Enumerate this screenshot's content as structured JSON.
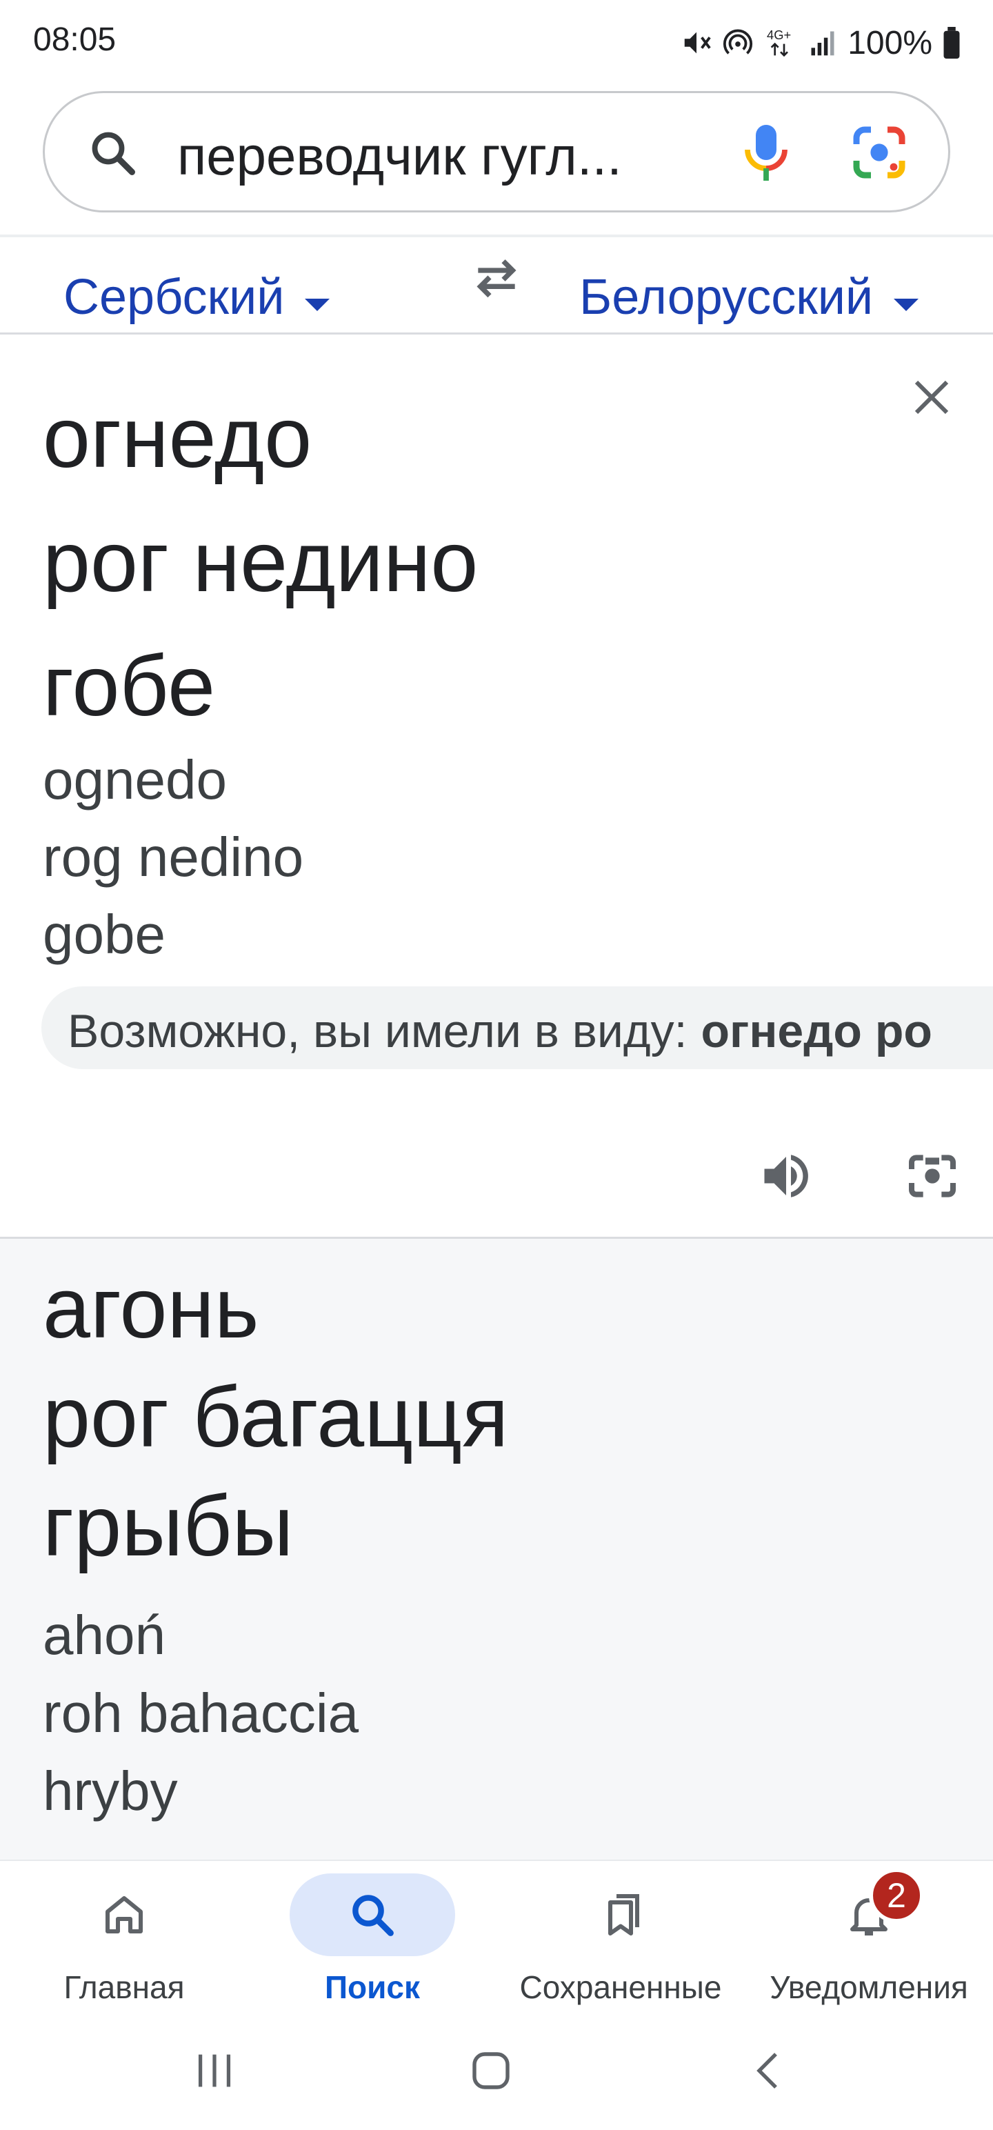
{
  "status_bar": {
    "time": "08:05",
    "battery": "100%",
    "network": "4G+",
    "icons": [
      "mute-icon",
      "hotspot-icon",
      "network-icon",
      "signal-icon",
      "battery-icon"
    ]
  },
  "search": {
    "query": "переводчик гугл...",
    "icons": [
      "search-icon",
      "mic-icon",
      "lens-icon"
    ]
  },
  "translator": {
    "source_lang": "Сербский",
    "target_lang": "Белорусский",
    "source_lines": [
      "огнедо",
      "рог недино",
      "гобе"
    ],
    "source_translit": [
      "ognedo",
      "rog nedino",
      "gobe"
    ],
    "suggestion_prefix": "Возможно, вы имели в виду:",
    "suggestion_value": "огнедо ро",
    "target_lines": [
      "агонь",
      "рог багацця",
      "грыбы"
    ],
    "target_translit": [
      "ahoń",
      "roh bahaccia",
      "hryby"
    ]
  },
  "bottom_nav": {
    "items": [
      {
        "label": "Главная",
        "icon": "home-icon",
        "active": false
      },
      {
        "label": "Поиск",
        "icon": "search-icon",
        "active": true
      },
      {
        "label": "Сохраненные",
        "icon": "bookmarks-icon",
        "active": false
      },
      {
        "label": "Уведомления",
        "icon": "bell-icon",
        "active": false
      }
    ],
    "notification_count": "2"
  },
  "colors": {
    "accent": "#1a3fb0",
    "active_nav": "#0b57d0",
    "active_pill": "#dde7fb",
    "badge": "#b3261e",
    "target_bg": "#f6f7f9"
  }
}
